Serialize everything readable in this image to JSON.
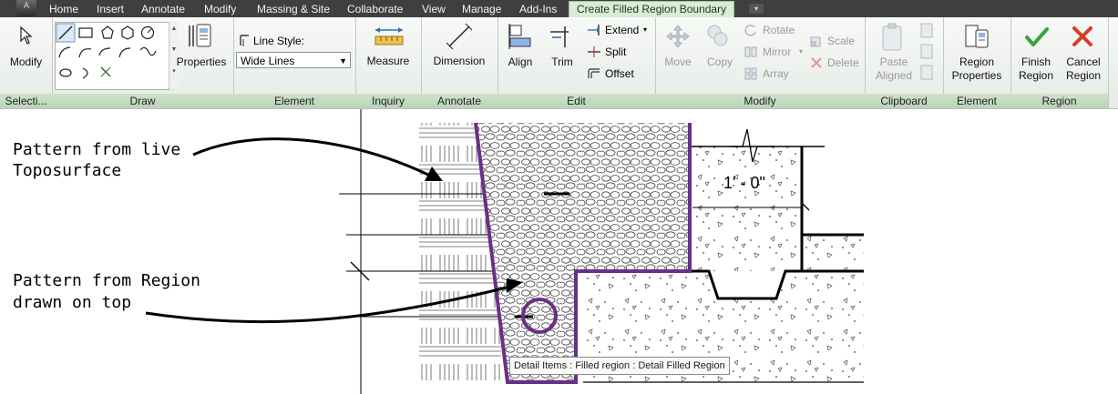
{
  "tabs": [
    "Home",
    "Insert",
    "Annotate",
    "Modify",
    "Massing & Site",
    "Collaborate",
    "View",
    "Manage",
    "Add-Ins",
    "Create Filled Region Boundary"
  ],
  "app_button": "A",
  "ribbon": {
    "select_panel": {
      "modify_label": "Modify",
      "title": "Selecti..."
    },
    "draw_panel": {
      "properties_label": "Properties",
      "title": "Draw"
    },
    "element_panel": {
      "line_style_label": "Line Style:",
      "line_style_value": "Wide Lines",
      "title": "Element"
    },
    "inquiry_panel": {
      "measure_label": "Measure",
      "title": "Inquiry"
    },
    "annotate_panel": {
      "dimension_label": "Dimension",
      "title": "Annotate"
    },
    "edit_panel": {
      "align_label": "Align",
      "trim_label": "Trim",
      "extend_label": "Extend",
      "split_label": "Split",
      "offset_label": "Offset",
      "title": "Edit"
    },
    "modify_panel": {
      "move_label": "Move",
      "copy_label": "Copy",
      "rotate_label": "Rotate",
      "mirror_label": "Mirror",
      "array_label": "Array",
      "scale_label": "Scale",
      "delete_label": "Delete",
      "title": "Modify"
    },
    "clipboard_panel": {
      "paste_label_1": "Paste",
      "paste_label_2": "Aligned",
      "title": "Clipboard"
    },
    "element2_panel": {
      "region_props_1": "Region",
      "region_props_2": "Properties",
      "title": "Element"
    },
    "region_panel": {
      "finish_1": "Finish",
      "finish_2": "Region",
      "cancel_1": "Cancel",
      "cancel_2": "Region",
      "title": "Region"
    }
  },
  "canvas": {
    "annotation_1_line1": "Pattern from live",
    "annotation_1_line2": "Toposurface",
    "annotation_2_line1": "Pattern from Region",
    "annotation_2_line2": "drawn on top",
    "dimension_text": "1' - 0\"",
    "tooltip": "Detail Items : Filled region : Detail Filled Region"
  },
  "colors": {
    "region_boundary": "#6b2f86",
    "ribbon_accent": "#b9d4b6",
    "finish_icon": "#3aa33a",
    "cancel_icon": "#d93a2b"
  }
}
